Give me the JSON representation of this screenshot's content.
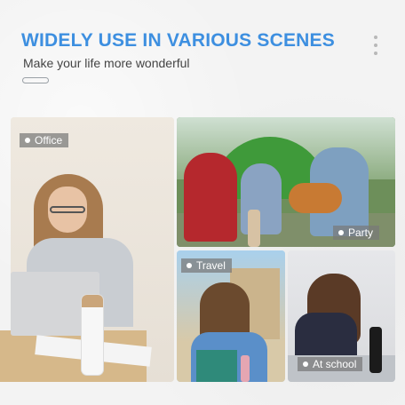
{
  "header": {
    "title": "WIDELY USE IN VARIOUS SCENES",
    "subtitle": "Make your life more wonderful"
  },
  "scenes": {
    "office": {
      "label": "Office"
    },
    "party": {
      "label": "Party"
    },
    "travel": {
      "label": "Travel"
    },
    "school": {
      "label": "At school"
    }
  },
  "colors": {
    "headline": "#3d8fe0",
    "tag_background": "#787878",
    "background": "#f3f3f3"
  },
  "icons": {
    "menu": "vertical-dots-icon",
    "tag_marker": "circle-icon"
  }
}
